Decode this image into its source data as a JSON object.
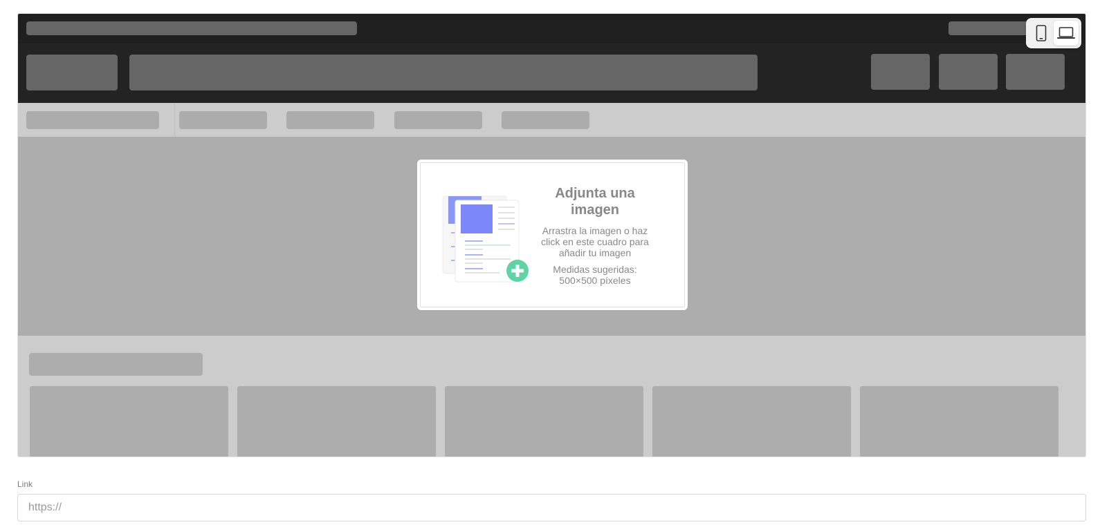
{
  "uploader": {
    "title": "Adjunta una imagen",
    "description": "Arrastra la imagen o haz click en este cuadro para añadir tu imagen",
    "hint": "Medidas sugeridas: 500×500 píxeles",
    "icon": "document-add-icon",
    "accent_color": "#6a7df5",
    "add_color": "#5fd3a6"
  },
  "device_toggle": {
    "options": [
      "mobile-icon",
      "laptop-icon"
    ],
    "selected": "laptop-icon"
  },
  "link": {
    "label": "Link",
    "value": "",
    "placeholder": "https://"
  }
}
